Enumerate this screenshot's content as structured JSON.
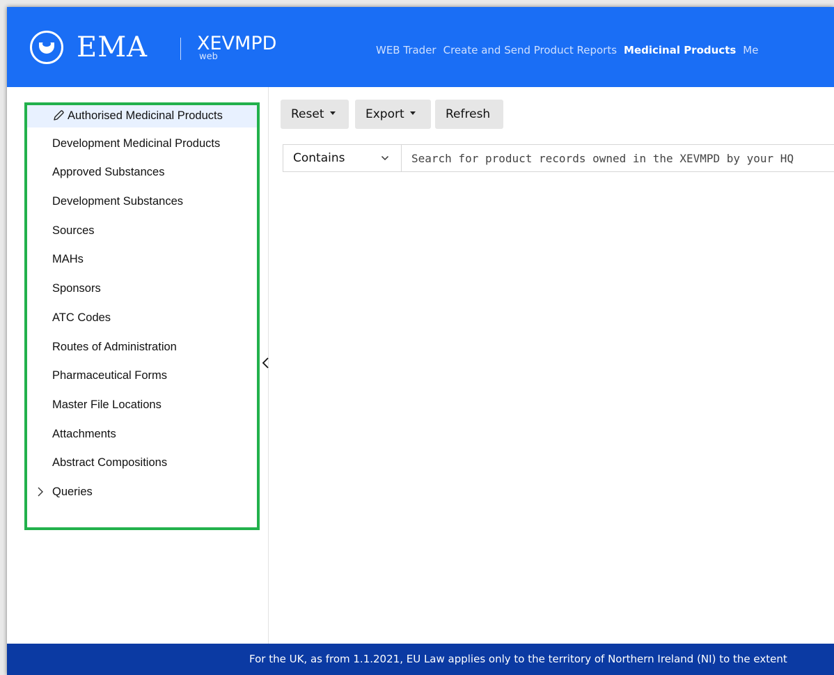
{
  "header": {
    "logo_text": "EMA",
    "app_name": "XEVMPD",
    "app_sub": "web",
    "nav": [
      "WEB Trader",
      "Create and Send Product Reports",
      "Medicinal Products",
      "Me"
    ],
    "active_nav": "Medicinal Products",
    "colors": {
      "header_bg": "#1a6ef5",
      "footer_bg": "#0b3aa3",
      "highlight": "#22b14c"
    }
  },
  "sidebar": {
    "items": [
      {
        "label": "Authorised Medicinal Products",
        "icon": "pencil-icon",
        "active": true
      },
      {
        "label": "Development Medicinal Products"
      },
      {
        "label": "Approved Substances"
      },
      {
        "label": "Development Substances"
      },
      {
        "label": "Sources"
      },
      {
        "label": "MAHs"
      },
      {
        "label": "Sponsors"
      },
      {
        "label": "ATC Codes"
      },
      {
        "label": "Routes of Administration"
      },
      {
        "label": "Pharmaceutical Forms"
      },
      {
        "label": "Master File Locations"
      },
      {
        "label": "Attachments"
      },
      {
        "label": "Abstract Compositions"
      },
      {
        "label": "Queries",
        "icon": "chevron-right-icon"
      }
    ]
  },
  "toolbar": {
    "reset_label": "Reset",
    "export_label": "Export",
    "refresh_label": "Refresh"
  },
  "search": {
    "mode": "Contains",
    "placeholder": "Search for product records owned in the XEVMPD by your HQ"
  },
  "footer": {
    "text": "For the UK, as from 1.1.2021, EU Law applies only to the territory of Northern Ireland (NI) to the extent"
  }
}
